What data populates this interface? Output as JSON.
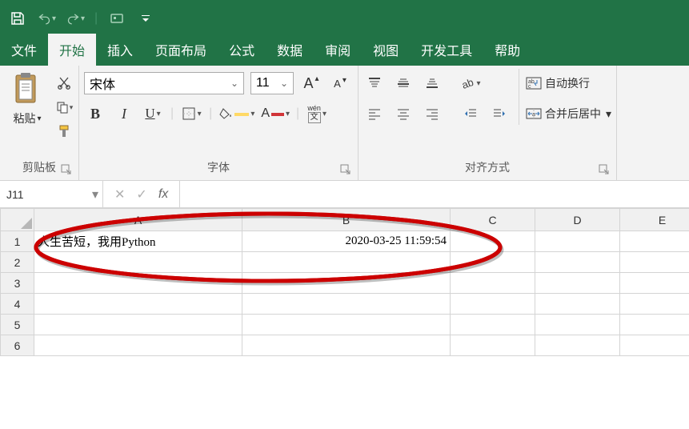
{
  "tabs": {
    "file": "文件",
    "home": "开始",
    "insert": "插入",
    "layout": "页面布局",
    "formulas": "公式",
    "data": "数据",
    "review": "审阅",
    "view": "视图",
    "dev": "开发工具",
    "help": "帮助"
  },
  "clipboard": {
    "paste": "粘贴",
    "group": "剪贴板"
  },
  "font": {
    "name": "宋体",
    "size": "11",
    "bold": "B",
    "italic": "I",
    "underline": "U",
    "wen": "wén",
    "wenchar": "文",
    "bigA": "A",
    "smallA": "A",
    "group": "字体"
  },
  "align": {
    "wrap": "自动换行",
    "merge": "合并后居中",
    "group": "对齐方式"
  },
  "namebox": "J11",
  "fx": "fx",
  "columns": {
    "A": "A",
    "B": "B",
    "C": "C",
    "D": "D",
    "E": "E"
  },
  "rows": {
    "1": "1",
    "2": "2",
    "3": "3",
    "4": "4",
    "5": "5",
    "6": "6"
  },
  "cells": {
    "A1": "人生苦短，我用Python",
    "B1": "2020-03-25 11:59:54"
  }
}
